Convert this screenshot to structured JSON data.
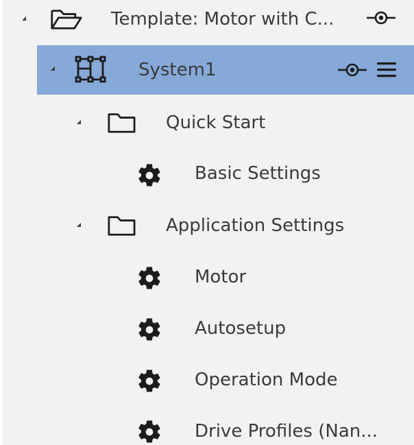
{
  "tree": {
    "template": {
      "label": "Template: Motor with C..."
    },
    "system": {
      "label": "System1"
    },
    "quick_start": {
      "label": "Quick Start",
      "items": [
        {
          "label": "Basic Settings"
        }
      ]
    },
    "application_settings": {
      "label": "Application Settings",
      "items": [
        {
          "label": "Motor"
        },
        {
          "label": "Autosetup"
        },
        {
          "label": "Operation Mode"
        },
        {
          "label": "Drive Profiles (Nan..."
        }
      ]
    }
  },
  "icons": {
    "folder_open": "folder-open-icon",
    "folder": "folder-icon",
    "system": "system-network-icon",
    "gear": "gear-icon",
    "connect": "connect-icon",
    "menu": "hamburger-menu-icon"
  },
  "colors": {
    "background": "#f2f2f2",
    "selected_row": "#86a9d8",
    "text": "#3a3a3a",
    "icon": "#1c1c1c"
  }
}
